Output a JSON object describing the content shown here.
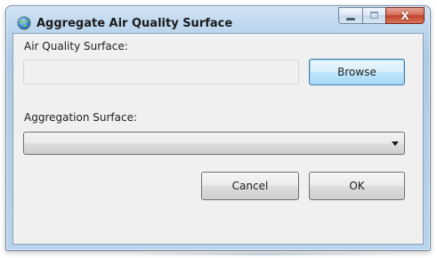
{
  "window": {
    "title": "Aggregate Air Quality Surface",
    "app_icon": "globe-icon",
    "caption_buttons": {
      "minimize_icon": "minimize-icon",
      "maximize_icon": "maximize-icon",
      "close_glyph": "X"
    }
  },
  "form": {
    "air_quality_label": "Air Quality Surface:",
    "air_quality_value": "",
    "browse_label": "Browse",
    "aggregation_label": "Aggregation Surface:",
    "aggregation_selected": "",
    "cancel_label": "Cancel",
    "ok_label": "OK"
  },
  "colors": {
    "frame": "#b9d3ec",
    "client": "#f0f0f0",
    "close_button": "#c0432a",
    "focus_button": "#3c7fb1"
  }
}
